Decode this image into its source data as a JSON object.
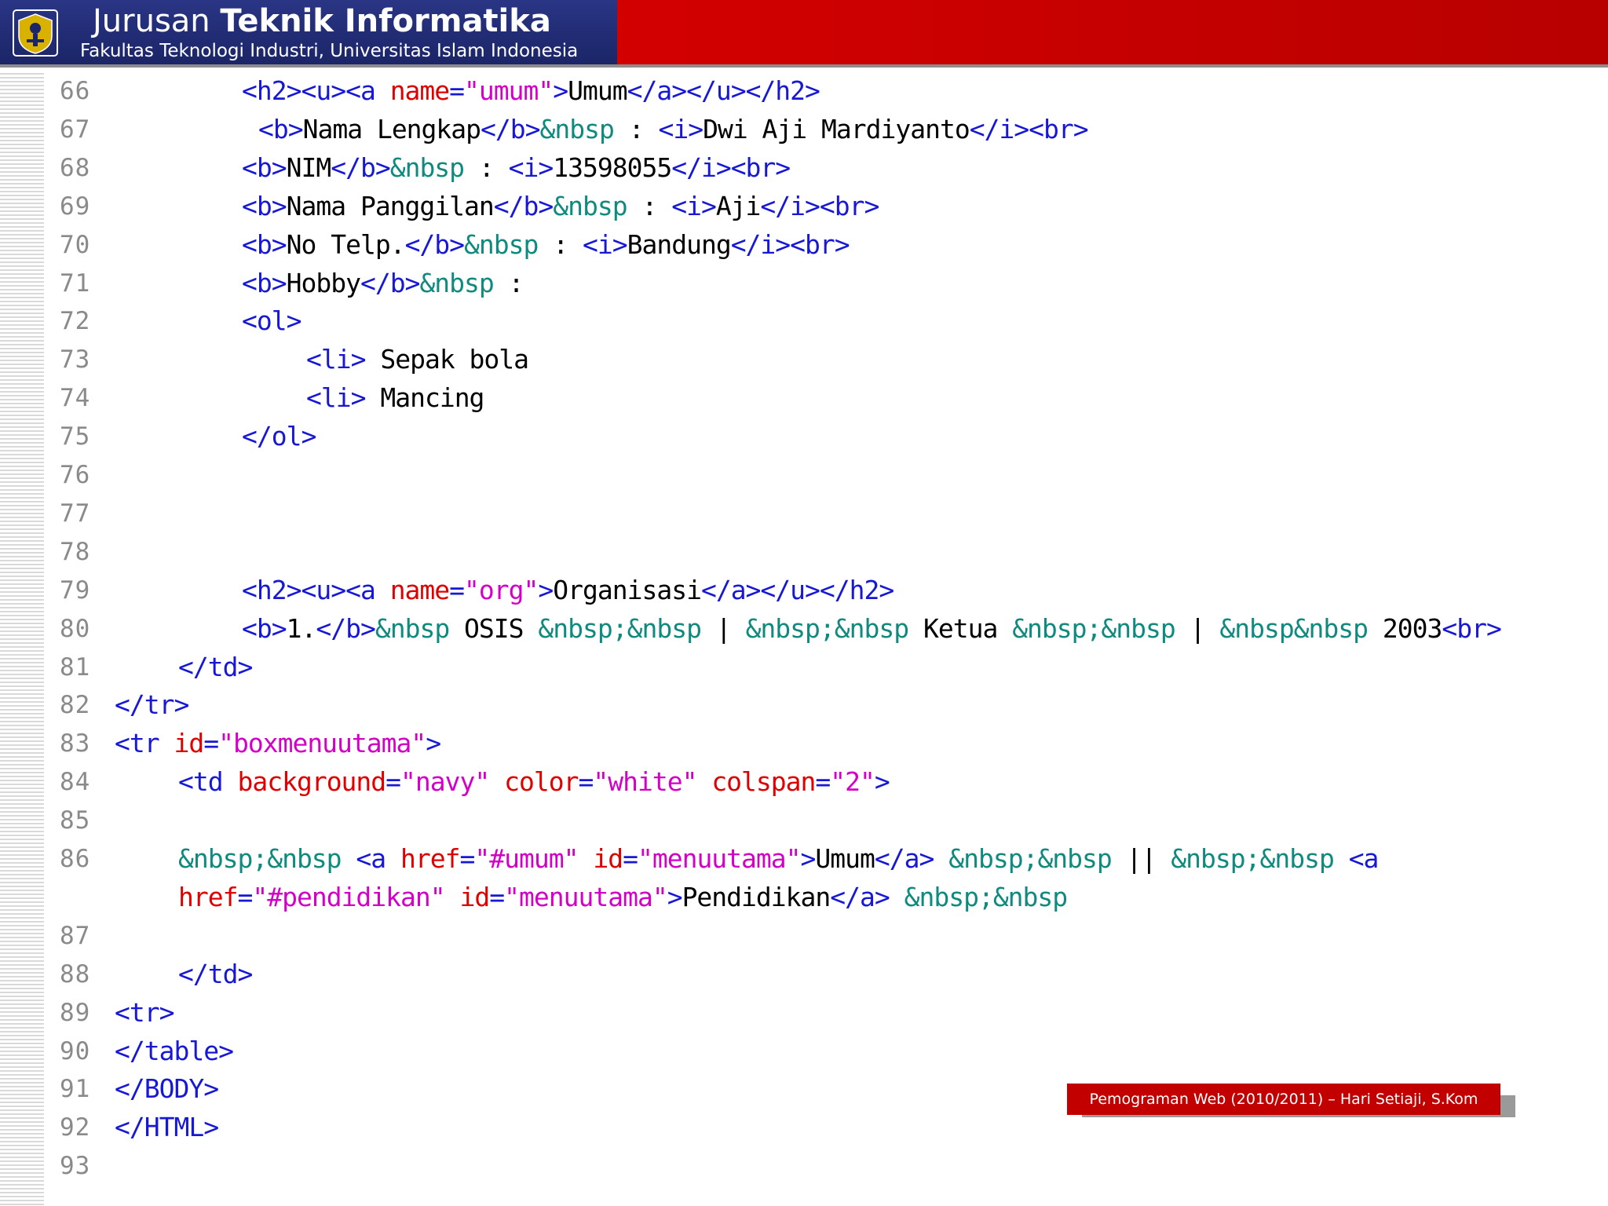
{
  "header": {
    "title_light": "Jurusan",
    "title_bold": "Teknik Informatika",
    "subtitle": "Fakultas Teknologi Industri, Universitas Islam Indonesia"
  },
  "footer": {
    "label": "Pemograman Web (2010/2011) – Hari Setiaji, S.Kom"
  },
  "colors": {
    "header_red": "#cc0000",
    "header_navy": "#1b2567",
    "tag": "#1717d6",
    "attribute": "#e00000",
    "string": "#d400c8",
    "entity": "#0f8a7e",
    "line_number": "#8a8a8a"
  },
  "code": {
    "lines": [
      {
        "n": "66",
        "indent": 8,
        "tokens": [
          [
            "t",
            "<h2><u><a "
          ],
          [
            "a",
            "name"
          ],
          [
            "t",
            "="
          ],
          [
            "s",
            "\"umum\""
          ],
          [
            "t",
            ">"
          ],
          [
            "x",
            "Umum"
          ],
          [
            "t",
            "</a></u></h2>"
          ]
        ]
      },
      {
        "n": "67",
        "indent": 9,
        "tokens": [
          [
            "t",
            "<b>"
          ],
          [
            "x",
            "Nama Lengkap"
          ],
          [
            "t",
            "</b>"
          ],
          [
            "e",
            "&nbsp"
          ],
          [
            "x",
            " : "
          ],
          [
            "t",
            "<i>"
          ],
          [
            "x",
            "Dwi Aji Mardiyanto"
          ],
          [
            "t",
            "</i><br>"
          ]
        ]
      },
      {
        "n": "68",
        "indent": 8,
        "tokens": [
          [
            "t",
            "<b>"
          ],
          [
            "x",
            "NIM"
          ],
          [
            "t",
            "</b>"
          ],
          [
            "e",
            "&nbsp"
          ],
          [
            "x",
            " : "
          ],
          [
            "t",
            "<i>"
          ],
          [
            "x",
            "13598055"
          ],
          [
            "t",
            "</i><br>"
          ]
        ]
      },
      {
        "n": "69",
        "indent": 8,
        "tokens": [
          [
            "t",
            "<b>"
          ],
          [
            "x",
            "Nama Panggilan"
          ],
          [
            "t",
            "</b>"
          ],
          [
            "e",
            "&nbsp"
          ],
          [
            "x",
            " : "
          ],
          [
            "t",
            "<i>"
          ],
          [
            "x",
            "Aji"
          ],
          [
            "t",
            "</i><br>"
          ]
        ]
      },
      {
        "n": "70",
        "indent": 8,
        "tokens": [
          [
            "t",
            "<b>"
          ],
          [
            "x",
            "No Telp."
          ],
          [
            "t",
            "</b>"
          ],
          [
            "e",
            "&nbsp"
          ],
          [
            "x",
            " : "
          ],
          [
            "t",
            "<i>"
          ],
          [
            "x",
            "Bandung"
          ],
          [
            "t",
            "</i><br>"
          ]
        ]
      },
      {
        "n": "71",
        "indent": 8,
        "tokens": [
          [
            "t",
            "<b>"
          ],
          [
            "x",
            "Hobby"
          ],
          [
            "t",
            "</b>"
          ],
          [
            "e",
            "&nbsp"
          ],
          [
            "x",
            " :"
          ]
        ]
      },
      {
        "n": "72",
        "indent": 8,
        "tokens": [
          [
            "t",
            "<ol>"
          ]
        ]
      },
      {
        "n": "73",
        "indent": 12,
        "tokens": [
          [
            "t",
            "<li>"
          ],
          [
            "x",
            " Sepak bola"
          ]
        ]
      },
      {
        "n": "74",
        "indent": 12,
        "tokens": [
          [
            "t",
            "<li>"
          ],
          [
            "x",
            " Mancing"
          ]
        ]
      },
      {
        "n": "75",
        "indent": 8,
        "tokens": [
          [
            "t",
            "</ol>"
          ]
        ]
      },
      {
        "n": "76",
        "indent": 0,
        "tokens": []
      },
      {
        "n": "77",
        "indent": 0,
        "tokens": []
      },
      {
        "n": "78",
        "indent": 0,
        "tokens": []
      },
      {
        "n": "79",
        "indent": 8,
        "tokens": [
          [
            "t",
            "<h2><u><a "
          ],
          [
            "a",
            "name"
          ],
          [
            "t",
            "="
          ],
          [
            "s",
            "\"org\""
          ],
          [
            "t",
            ">"
          ],
          [
            "x",
            "Organisasi"
          ],
          [
            "t",
            "</a></u></h2>"
          ]
        ]
      },
      {
        "n": "80",
        "indent": 8,
        "tokens": [
          [
            "t",
            "<b>"
          ],
          [
            "x",
            "1."
          ],
          [
            "t",
            "</b>"
          ],
          [
            "e",
            "&nbsp"
          ],
          [
            "x",
            " OSIS "
          ],
          [
            "e",
            "&nbsp;&nbsp"
          ],
          [
            "x",
            " | "
          ],
          [
            "e",
            "&nbsp;&nbsp"
          ],
          [
            "x",
            " Ketua "
          ],
          [
            "e",
            "&nbsp;&nbsp"
          ],
          [
            "x",
            " | "
          ],
          [
            "e",
            "&nbsp&nbsp"
          ],
          [
            "x",
            " 2003"
          ],
          [
            "t",
            "<br>"
          ]
        ]
      },
      {
        "n": "81",
        "indent": 4,
        "tokens": [
          [
            "t",
            "</td>"
          ]
        ]
      },
      {
        "n": "82",
        "indent": 0,
        "tokens": [
          [
            "t",
            "</tr>"
          ]
        ]
      },
      {
        "n": "83",
        "indent": 0,
        "tokens": [
          [
            "t",
            "<tr "
          ],
          [
            "a",
            "id"
          ],
          [
            "t",
            "="
          ],
          [
            "s",
            "\"boxmenuutama\""
          ],
          [
            "t",
            ">"
          ]
        ]
      },
      {
        "n": "84",
        "indent": 4,
        "tokens": [
          [
            "t",
            "<td "
          ],
          [
            "a",
            "background"
          ],
          [
            "t",
            "="
          ],
          [
            "s",
            "\"navy\""
          ],
          [
            "x",
            " "
          ],
          [
            "a",
            "color"
          ],
          [
            "t",
            "="
          ],
          [
            "s",
            "\"white\""
          ],
          [
            "x",
            " "
          ],
          [
            "a",
            "colspan"
          ],
          [
            "t",
            "="
          ],
          [
            "s",
            "\"2\""
          ],
          [
            "t",
            ">"
          ]
        ]
      },
      {
        "n": "85",
        "indent": 0,
        "tokens": []
      },
      {
        "n": "86",
        "indent": 4,
        "tokens": [
          [
            "e",
            "&nbsp;&nbsp"
          ],
          [
            "x",
            " "
          ],
          [
            "t",
            "<a "
          ],
          [
            "a",
            "href"
          ],
          [
            "t",
            "="
          ],
          [
            "s",
            "\"#umum\""
          ],
          [
            "x",
            " "
          ],
          [
            "a",
            "id"
          ],
          [
            "t",
            "="
          ],
          [
            "s",
            "\"menuutama\""
          ],
          [
            "t",
            ">"
          ],
          [
            "x",
            "Umum"
          ],
          [
            "t",
            "</a>"
          ],
          [
            "x",
            " "
          ],
          [
            "e",
            "&nbsp;&nbsp"
          ],
          [
            "x",
            " || "
          ],
          [
            "e",
            "&nbsp;&nbsp"
          ],
          [
            "x",
            " "
          ],
          [
            "t",
            "<a"
          ]
        ]
      },
      {
        "n": "",
        "indent": 4,
        "tokens": [
          [
            "a",
            "href"
          ],
          [
            "t",
            "="
          ],
          [
            "s",
            "\"#pendidikan\""
          ],
          [
            "x",
            " "
          ],
          [
            "a",
            "id"
          ],
          [
            "t",
            "="
          ],
          [
            "s",
            "\"menuutama\""
          ],
          [
            "t",
            ">"
          ],
          [
            "x",
            "Pendidikan"
          ],
          [
            "t",
            "</a>"
          ],
          [
            "x",
            " "
          ],
          [
            "e",
            "&nbsp;&nbsp"
          ]
        ]
      },
      {
        "n": "87",
        "indent": 0,
        "tokens": []
      },
      {
        "n": "88",
        "indent": 4,
        "tokens": [
          [
            "t",
            "</td>"
          ]
        ]
      },
      {
        "n": "89",
        "indent": 0,
        "tokens": [
          [
            "t",
            "<tr>"
          ]
        ]
      },
      {
        "n": "90",
        "indent": 0,
        "tokens": [
          [
            "t",
            "</table>"
          ]
        ]
      },
      {
        "n": "91",
        "indent": 0,
        "tokens": [
          [
            "t",
            "</BODY>"
          ]
        ]
      },
      {
        "n": "92",
        "indent": 0,
        "tokens": [
          [
            "t",
            "</HTML>"
          ]
        ]
      },
      {
        "n": "93",
        "indent": 0,
        "tokens": []
      }
    ]
  }
}
